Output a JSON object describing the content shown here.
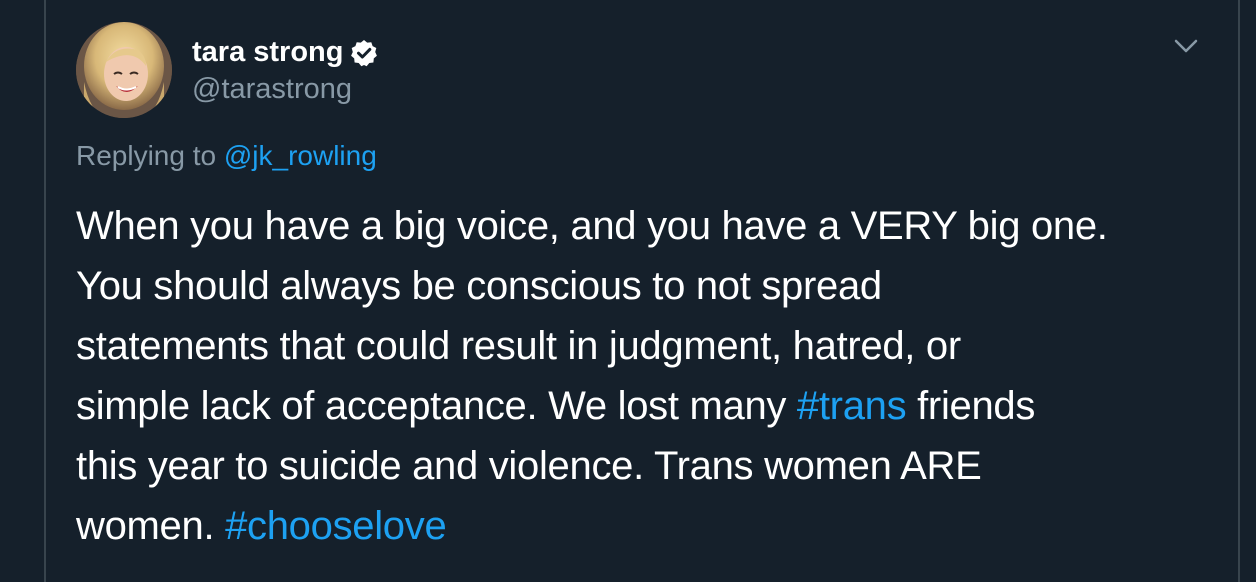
{
  "author": {
    "display_name": "tara strong",
    "handle": "@tarastrong",
    "verified_icon": "verified-badge-icon",
    "avatar_icon": "profile-photo"
  },
  "menu": {
    "icon": "chevron-down-icon"
  },
  "reply_context": {
    "prefix": "Replying to ",
    "mention": "@jk_rowling"
  },
  "tweet": {
    "line1": "When you have a big voice, and you have a VERY big one.",
    "line2": "You should always be conscious to not spread",
    "line3": "statements that could result in judgment, hatred, or",
    "line4_before": "simple lack of acceptance. We lost many ",
    "line4_hashtag": "#trans",
    "line4_after": " friends",
    "line5": "this year to suicide and violence. Trans women ARE",
    "line6_before": "women. ",
    "line6_hashtag": "#chooselove"
  },
  "colors": {
    "background": "#15202b",
    "text": "#ffffff",
    "secondary_text": "#8899a6",
    "link": "#1da1f2",
    "border": "#38444d"
  }
}
